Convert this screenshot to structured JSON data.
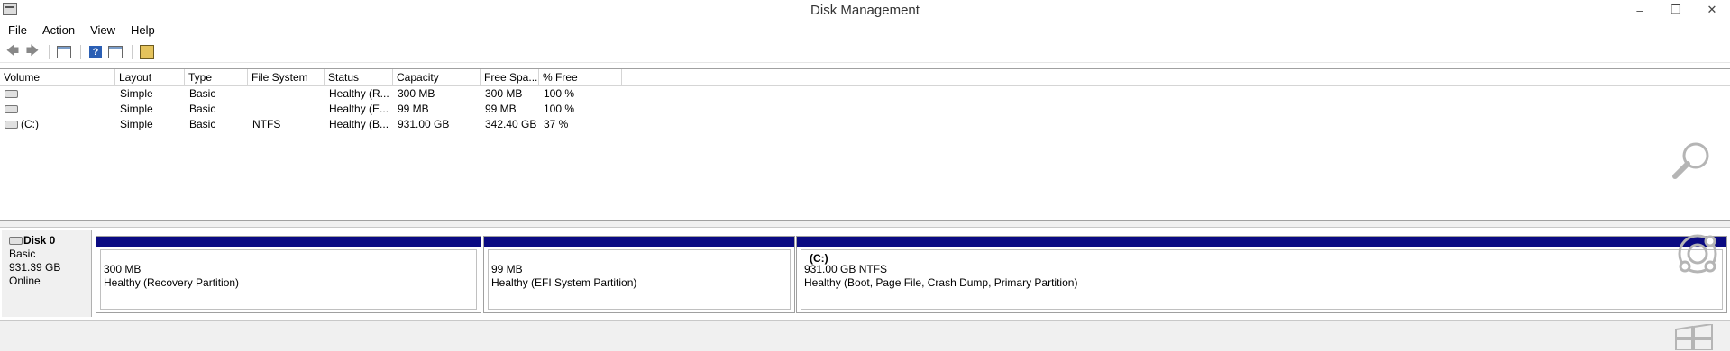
{
  "window": {
    "title": "Disk Management"
  },
  "menu": [
    "File",
    "Action",
    "View",
    "Help"
  ],
  "toolbar": {
    "buttons": [
      "back-icon",
      "forward-icon",
      "show-hide-console-tree-icon",
      "help-icon",
      "layout-icon",
      "properties-icon"
    ]
  },
  "volumes": {
    "headers": [
      "Volume",
      "Layout",
      "Type",
      "File System",
      "Status",
      "Capacity",
      "Free Spa...",
      "% Free"
    ],
    "rows": [
      {
        "volume": "",
        "layout": "Simple",
        "type": "Basic",
        "fs": "",
        "status": "Healthy (R...",
        "capacity": "300 MB",
        "free": "300 MB",
        "pct": "100 %"
      },
      {
        "volume": "",
        "layout": "Simple",
        "type": "Basic",
        "fs": "",
        "status": "Healthy (E...",
        "capacity": "99 MB",
        "free": "99 MB",
        "pct": "100 %"
      },
      {
        "volume": "(C:)",
        "layout": "Simple",
        "type": "Basic",
        "fs": "NTFS",
        "status": "Healthy (B...",
        "capacity": "931.00 GB",
        "free": "342.40 GB",
        "pct": "37 %"
      }
    ]
  },
  "disk": {
    "name": "Disk 0",
    "type": "Basic",
    "size": "931.39 GB",
    "state": "Online",
    "partitions": [
      {
        "name": "",
        "size": "300 MB",
        "status": "Healthy (Recovery Partition)"
      },
      {
        "name": "",
        "size": "99 MB",
        "status": "Healthy (EFI System Partition)"
      },
      {
        "name": "(C:)",
        "size": "931.00 GB NTFS",
        "status": "Healthy (Boot, Page File, Crash Dump, Primary Partition)"
      }
    ]
  },
  "colors": {
    "partition_bar": "#0a0a82",
    "accent": "#2b5fb4"
  }
}
